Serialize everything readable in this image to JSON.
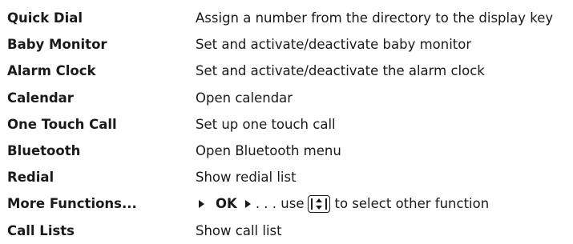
{
  "rows": [
    {
      "name": "Quick Dial",
      "description": "Assign a number from the directory to the display key"
    },
    {
      "name": "Baby Monitor",
      "description": "Set and activate/deactivate baby monitor"
    },
    {
      "name": "Alarm Clock",
      "description": "Set and activate/deactivate the alarm clock"
    },
    {
      "name": "Calendar",
      "description": "Open calendar"
    },
    {
      "name": "One Touch Call",
      "description": "Set up one touch call"
    },
    {
      "name": "Bluetooth",
      "description": "Open Bluetooth menu"
    },
    {
      "name": "Redial",
      "description": "Show redial list"
    },
    {
      "name": "More Functions...",
      "description_parts": {
        "ok": "OK",
        "prefix": ". . . use",
        "suffix": "to select other function",
        "icon": "navigation-key-up-down-icon"
      }
    },
    {
      "name": "Call Lists",
      "description": "Show call list"
    }
  ]
}
